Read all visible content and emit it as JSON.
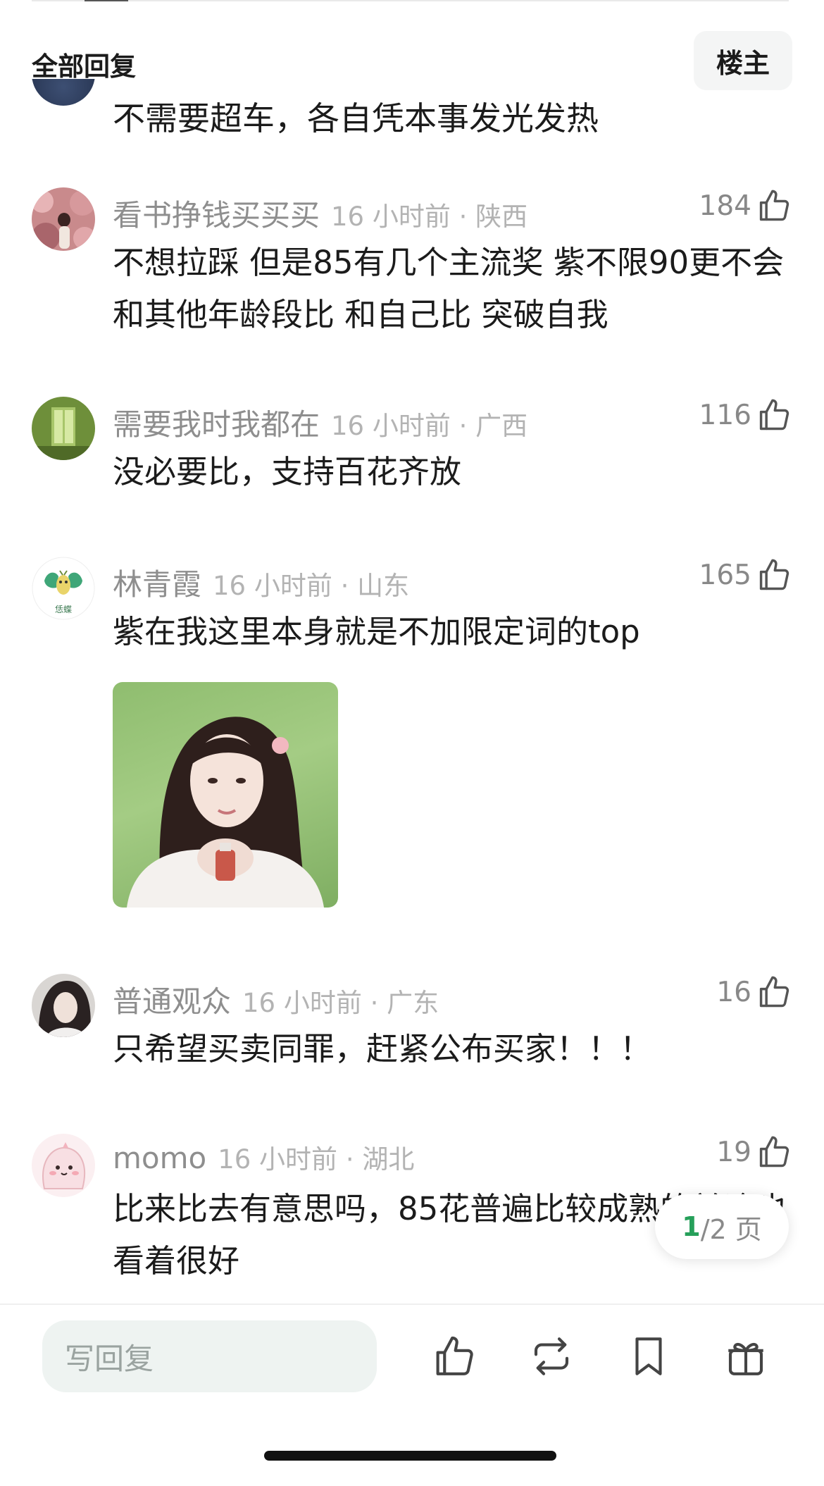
{
  "header": {
    "title": "全部回复",
    "owner_button": "楼主"
  },
  "partial_comment": {
    "text": "不需要超车，各自凭本事发光发热"
  },
  "comments": [
    {
      "username": "看书挣钱买买买",
      "time_location": "16 小时前 · 陕西",
      "likes": "184",
      "text": "不想拉踩 但是85有几个主流奖 紫不限90更不会和其他年龄段比 和自己比 突破自我"
    },
    {
      "username": "需要我时我都在",
      "time_location": "16 小时前 · 广西",
      "likes": "116",
      "text": "没必要比，支持百花齐放"
    },
    {
      "username": "林青霞",
      "time_location": "16 小时前 · 山东",
      "likes": "165",
      "text": "紫在我这里本身就是不加限定词的top",
      "avatar_label": "恁蝶"
    },
    {
      "username": "普通观众",
      "time_location": "16 小时前 · 广东",
      "likes": "16",
      "text": "只希望买卖同罪，赶紧公布买家！！！"
    },
    {
      "username": "momo",
      "time_location": "16 小时前 · 湖北",
      "likes": "19",
      "text": "比来比去有意思吗，85花普遍比较成熟的前途也看着很好"
    }
  ],
  "pagination": {
    "current": "1",
    "rest": "/2 页"
  },
  "bottom_bar": {
    "reply_placeholder": "写回复",
    "icons": [
      "thumbs-up-icon",
      "repost-icon",
      "bookmark-icon",
      "gift-icon"
    ]
  },
  "colors": {
    "accent": "#26a05a",
    "muted_text": "#8e8e8e",
    "input_bg": "#eef3f1"
  }
}
